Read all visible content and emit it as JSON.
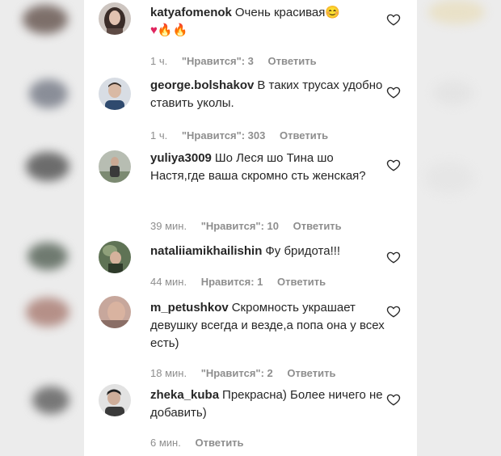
{
  "comments": [
    {
      "username": "katyafomenok",
      "text": "Очень красивая😊",
      "emoji_line": "♥🔥🔥",
      "time": "1 ч.",
      "likes": "\"Нравится\": 3",
      "reply": "Ответить"
    },
    {
      "username": "george.bolshakov",
      "text": "В таких трусах удобно ставить уколы.",
      "time": "1 ч.",
      "likes": "\"Нравится\": 303",
      "reply": "Ответить"
    },
    {
      "username": "yuliya3009",
      "text": "Шо Леся шо Тина шо Настя,где ваша скромно сть женская?",
      "time": "39 мин.",
      "likes": "\"Нравится\": 10",
      "reply": "Ответить"
    },
    {
      "username": "nataliiamikhailishin",
      "text": "Фу бридота!!!",
      "time": "44 мин.",
      "likes": "Нравится: 1",
      "reply": "Ответить"
    },
    {
      "username": "m_petushkov",
      "text": "Скромность украшает девушку всегда и везде,а попа она у всех есть)",
      "time": "18 мин.",
      "likes": "\"Нравится\": 2",
      "reply": "Ответить"
    },
    {
      "username": "zheka_kuba",
      "text": "Прекрасна) Более ничего не добавить)",
      "time": "6 мин.",
      "reply": "Ответить"
    }
  ],
  "icons": {
    "like": "heart-outline-icon"
  },
  "colors": {
    "text": "#262626",
    "meta": "#8e8e8e",
    "red_heart": "#e0245e"
  }
}
